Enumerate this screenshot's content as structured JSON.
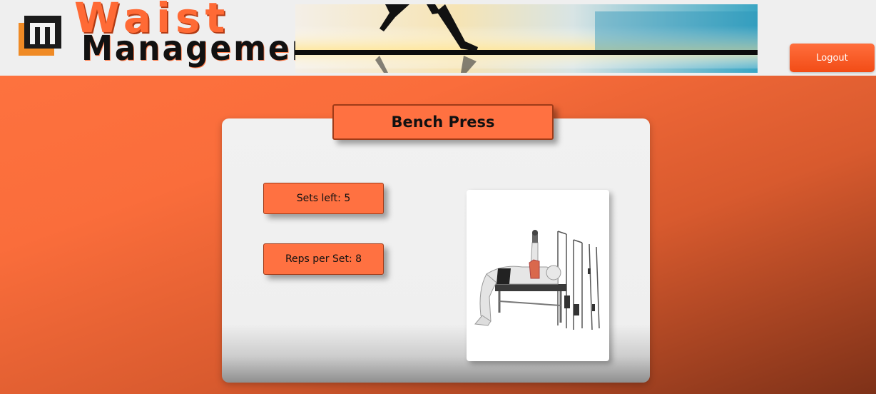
{
  "header": {
    "logo_word_1": "Waist",
    "logo_word_2": "Management",
    "logout_label": "Logout"
  },
  "exercise": {
    "title": "Bench Press",
    "sets_left_text": "Sets left: 5",
    "reps_per_set_text": "Reps per Set: 8"
  },
  "colors": {
    "accent": "#ff7141",
    "logout": "#f24c16",
    "header_bg": "#efefef",
    "panel_bg": "#f1f1f1"
  }
}
